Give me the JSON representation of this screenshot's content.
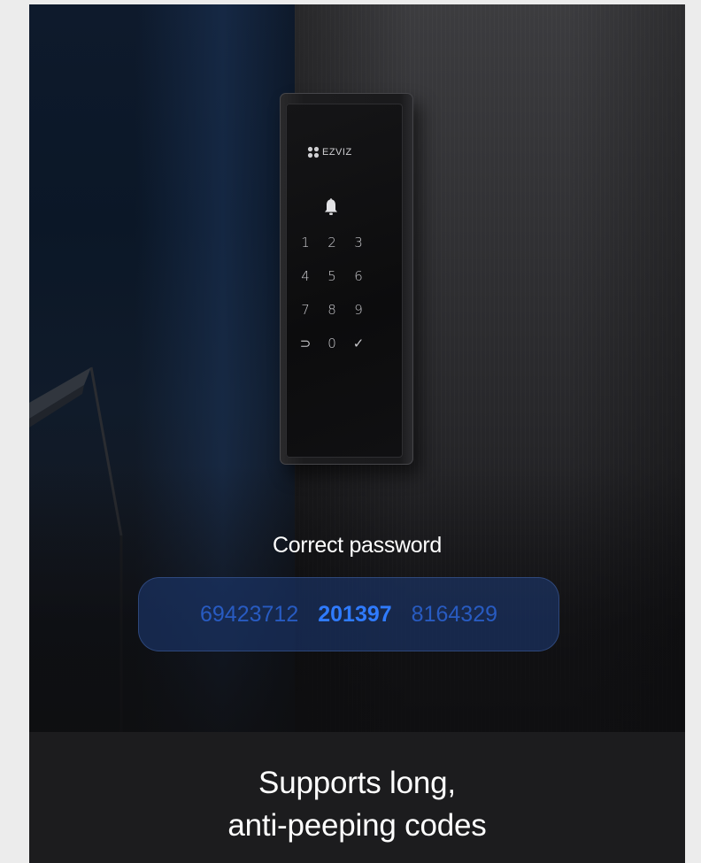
{
  "keypad": {
    "brand": "EZVIZ",
    "keys": [
      "1",
      "2",
      "3",
      "4",
      "5",
      "6",
      "7",
      "8",
      "9",
      "⊃",
      "0",
      "✓"
    ]
  },
  "password_panel": {
    "label": "Correct password",
    "noise_before": "69423712",
    "code": "201397",
    "noise_after": "8164329"
  },
  "caption": {
    "line1": "Supports long,",
    "line2": "anti-peeping codes"
  },
  "colors": {
    "code_highlight": "#2f7bff",
    "code_noise": "#2b64d6",
    "pill_background": "#1c376e",
    "caption_background": "#1c1c1e"
  }
}
